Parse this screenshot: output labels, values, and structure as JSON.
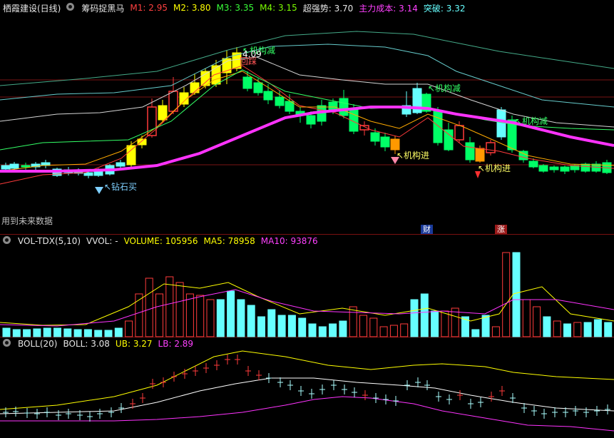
{
  "top_header": {
    "stock": "栖霞建设(日线)",
    "indicator": "筹码捉黑马",
    "m1_label": "M1:",
    "m1": "2.95",
    "m2_label": "M2:",
    "m2": "3.80",
    "m3_label": "M3:",
    "m3": "3.35",
    "m4_label": "M4:",
    "m4": "3.15",
    "strong_label": "超强势:",
    "strong": "3.70",
    "main_cost_label": "主力成本:",
    "main_cost": "3.14",
    "break_label": "突破:",
    "break": "3.32"
  },
  "note_future": "用到未来数据",
  "badges": {
    "fin": "财",
    "rise": "涨"
  },
  "vol_header": {
    "name": "VOL-TDX(5,10)",
    "vvol": "VVOL: -",
    "volume_label": "VOLUME:",
    "volume": "105956",
    "ma5_label": "MA5:",
    "ma5": "78958",
    "ma10_label": "MA10:",
    "ma10": "93876"
  },
  "boll_header": {
    "name": "BOLL(20)",
    "boll_label": "BOLL:",
    "boll": "3.08",
    "ub_label": "UB:",
    "ub": "3.27",
    "lb_label": "LB:",
    "lb": "2.89"
  },
  "colors": {
    "up": "#ff3b3b",
    "down": "#00ff66",
    "flat": "#66ffff",
    "yellow": "#ffff00",
    "magenta": "#ff33ff",
    "white": "#ffffff"
  },
  "chart_data": [
    {
      "type": "candlestick",
      "annotations": [
        {
          "text": "钻石买",
          "kind": "diamond"
        },
        {
          "text": "机构减",
          "kind": "label"
        },
        {
          "text": "机构进",
          "kind": "label"
        },
        {
          "text": "回踩",
          "kind": "label"
        },
        {
          "text": "4.09",
          "kind": "label"
        }
      ]
    },
    {
      "type": "bar",
      "name": "VOL-TDX"
    },
    {
      "type": "line",
      "name": "BOLL"
    }
  ]
}
